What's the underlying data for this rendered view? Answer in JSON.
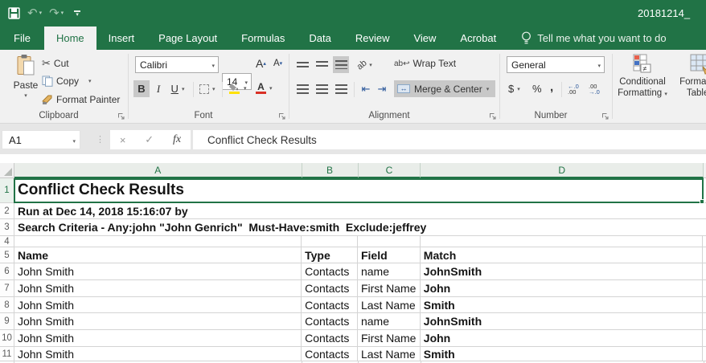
{
  "window": {
    "title": "20181214_"
  },
  "icons": {
    "dropdown": "▾",
    "undo": "↶",
    "redo": "↷",
    "scissors": "✂",
    "close": "×",
    "check": "✓",
    "ellipsis": "⋮",
    "orientation_text": "ab",
    "wrap_glyph": "ab↩",
    "merge_arrows": "↔",
    "indent_left": "⇤",
    "indent_right": "⇥",
    "increase_decimal_top": "←.0",
    "increase_decimal_bottom": ".00",
    "decrease_decimal_top": ".00",
    "decrease_decimal_bottom": "→.0",
    "grow_font_arrow": "▴",
    "shrink_font_arrow": "▾"
  },
  "tabs": {
    "file": "File",
    "items": [
      "Home",
      "Insert",
      "Page Layout",
      "Formulas",
      "Data",
      "Review",
      "View",
      "Acrobat"
    ],
    "active": "Home",
    "tell_me": "Tell me what you want to do"
  },
  "ribbon": {
    "clipboard": {
      "label": "Clipboard",
      "paste": "Paste",
      "cut": "Cut",
      "copy": "Copy",
      "format_painter": "Format Painter"
    },
    "font": {
      "label": "Font",
      "family": "Calibri",
      "size": "14",
      "bold": "B",
      "italic": "I",
      "underline": "U",
      "grow": "A",
      "shrink": "A",
      "color_letter": "A"
    },
    "alignment": {
      "label": "Alignment",
      "wrap_text": "Wrap Text",
      "merge_center": "Merge & Center"
    },
    "number": {
      "label": "Number",
      "format": "General",
      "currency": "$",
      "percent": "%",
      "comma": ","
    },
    "styles": {
      "conditional_line1": "Conditional",
      "conditional_line2": "Formatting",
      "format_table_line1": "Format as",
      "format_table_line2": "Table"
    }
  },
  "formula_bar": {
    "name_box": "A1",
    "fx_label": "fx",
    "value": "Conflict Check Results"
  },
  "sheet": {
    "columns": [
      "A",
      "B",
      "C",
      "D"
    ],
    "rows": [
      {
        "num": "1",
        "cells": [
          "Conflict Check Results"
        ]
      },
      {
        "num": "2",
        "cells": [
          "Run at Dec 14, 2018 15:16:07 by"
        ]
      },
      {
        "num": "3",
        "cells": [
          "Search Criteria - Any:john \"John Genrich\"  Must-Have:smith  Exclude:jeffrey"
        ]
      },
      {
        "num": "4",
        "cells": [
          "",
          "",
          "",
          ""
        ]
      },
      {
        "num": "5",
        "cells": [
          "Name",
          "Type",
          "Field",
          "Match"
        ]
      },
      {
        "num": "6",
        "cells": [
          "John Smith",
          "Contacts",
          "name",
          "JohnSmith"
        ]
      },
      {
        "num": "7",
        "cells": [
          "John Smith",
          "Contacts",
          "First Name",
          "John"
        ]
      },
      {
        "num": "8",
        "cells": [
          "John Smith",
          "Contacts",
          "Last Name",
          "Smith"
        ]
      },
      {
        "num": "9",
        "cells": [
          "John Smith",
          "Contacts",
          "name",
          "JohnSmith"
        ]
      },
      {
        "num": "10",
        "cells": [
          "John Smith",
          "Contacts",
          "First Name",
          "John"
        ]
      },
      {
        "num": "11",
        "cells": [
          "John Smith",
          "Contacts",
          "Last Name",
          "Smith"
        ]
      }
    ]
  },
  "colors": {
    "accent_green": "#217346",
    "ribbon_bg": "#f1f1f1",
    "gridline": "#d4d4d4",
    "toggle_gray": "#c8c8c8"
  }
}
